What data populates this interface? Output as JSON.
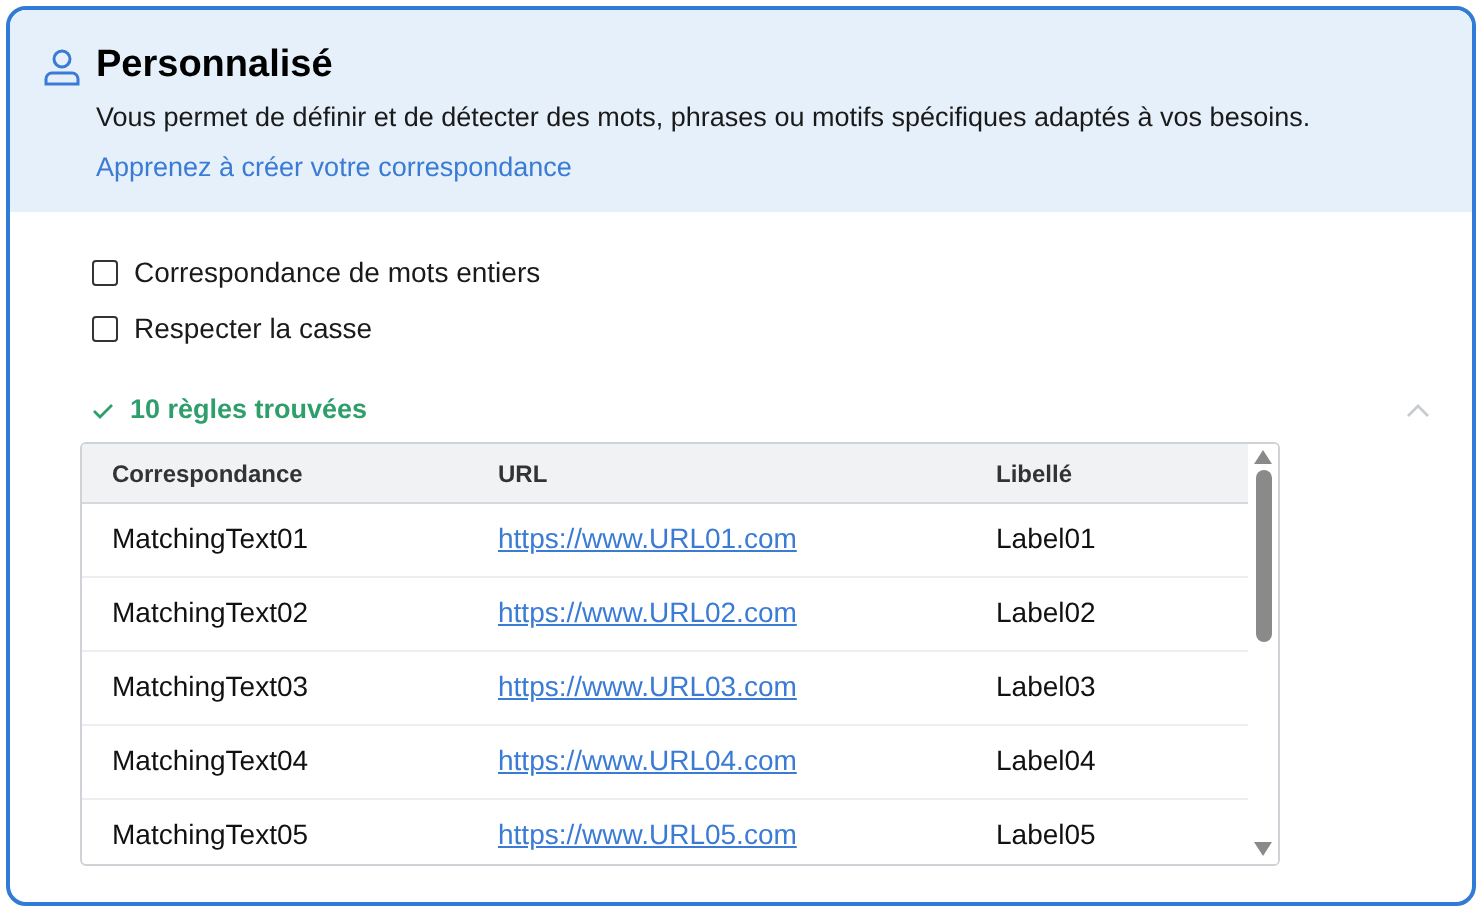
{
  "panel": {
    "title": "Personnalisé",
    "description": "Vous permet de définir et de détecter des mots, phrases ou motifs spécifiques adaptés à vos besoins.",
    "link": "Apprenez à créer votre correspondance"
  },
  "options": [
    {
      "label": "Correspondance de mots entiers",
      "checked": false
    },
    {
      "label": "Respecter la casse",
      "checked": false
    }
  ],
  "results": {
    "label": "10 règles trouvées",
    "expanded": true
  },
  "table": {
    "columns": [
      "Correspondance",
      "URL",
      "Libellé"
    ],
    "rows": [
      [
        "MatchingText01",
        "https://www.URL01.com",
        "Label01"
      ],
      [
        "MatchingText02",
        "https://www.URL02.com",
        "Label02"
      ],
      [
        "MatchingText03",
        "https://www.URL03.com",
        "Label03"
      ],
      [
        "MatchingText04",
        "https://www.URL04.com",
        "Label04"
      ],
      [
        "MatchingText05",
        "https://www.URL05.com",
        "Label05"
      ]
    ]
  }
}
